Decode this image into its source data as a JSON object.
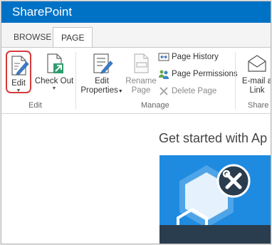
{
  "app": {
    "title": "SharePoint"
  },
  "tabs": [
    {
      "label": "BROWSE"
    },
    {
      "label": "PAGE"
    }
  ],
  "ribbon": {
    "edit_group": {
      "label": "Edit",
      "edit_button": "Edit",
      "checkout_button": "Check Out"
    },
    "manage_group": {
      "label": "Manage",
      "edit_properties_line1": "Edit",
      "edit_properties_line2": "Properties",
      "rename_line1": "Rename",
      "rename_line2": "Page",
      "page_history": "Page History",
      "page_permissions": "Page Permissions",
      "delete_page": "Delete Page"
    },
    "share_group": {
      "label": "Share",
      "email_line1": "E-mail a",
      "email_line2": "Link"
    }
  },
  "main": {
    "get_started_title": "Get started with Ap"
  },
  "colors": {
    "suite_bar": "#0072c6",
    "tile": "#1e8be0",
    "highlight": "#d53a3a"
  }
}
